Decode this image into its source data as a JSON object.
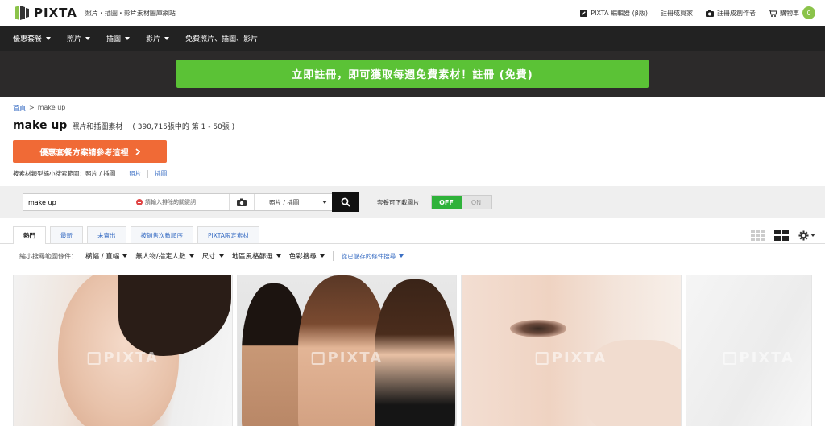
{
  "brand": {
    "name": "PIXTA",
    "tagline": "照片・插圖・影片素材圖庫網站"
  },
  "topnav": {
    "editor": "PIXTA 編輯器 (β版)",
    "buyer": "註冊成買家",
    "creator": "註冊成創作者",
    "cart": "購物車",
    "cart_count": "0"
  },
  "mainnav": [
    "優惠套餐",
    "照片",
    "插圖",
    "影片",
    "免費照片、插圖、影片"
  ],
  "banner": {
    "text": "立即註冊，即可獲取每週免費素材！註冊 (免費)"
  },
  "breadcrumb": {
    "home": "首頁",
    "separator": ">",
    "current": "make up"
  },
  "heading": {
    "keyword": "make up",
    "subtitle": "照片和插圖素材",
    "count": "( 390,715張中的 第 1 - 50張 )"
  },
  "promo": {
    "label": "優惠套餐方案請參考這裡"
  },
  "type_filter": {
    "label": "按素材類型縮小搜索範圍：",
    "current": "照片 / 插圖",
    "photo": "照片",
    "illustration": "插圖"
  },
  "search": {
    "value": "make up",
    "exclude_placeholder": "請輸入排除的關鍵詞",
    "type_select": "照片 / 插圖",
    "downloadable_label": "套餐可下載圖片",
    "toggle_off": "OFF",
    "toggle_on": "ON"
  },
  "tabs": [
    "熱門",
    "最新",
    "未賣出",
    "按銷售次數順序",
    "PIXTA限定素材"
  ],
  "filters": {
    "label": "縮小搜尋範圍條件：",
    "items": [
      "橫幅 / 直幅",
      "無人物/指定人數",
      "尺寸",
      "地區風格篩選",
      "色彩搜尋"
    ],
    "saved": "從已儲存的條件搜尋"
  },
  "images": [
    {
      "watermark": "PIXTA"
    },
    {
      "watermark": "PIXTA"
    },
    {
      "watermark": "PIXTA"
    },
    {
      "watermark": "PIXTA"
    }
  ]
}
